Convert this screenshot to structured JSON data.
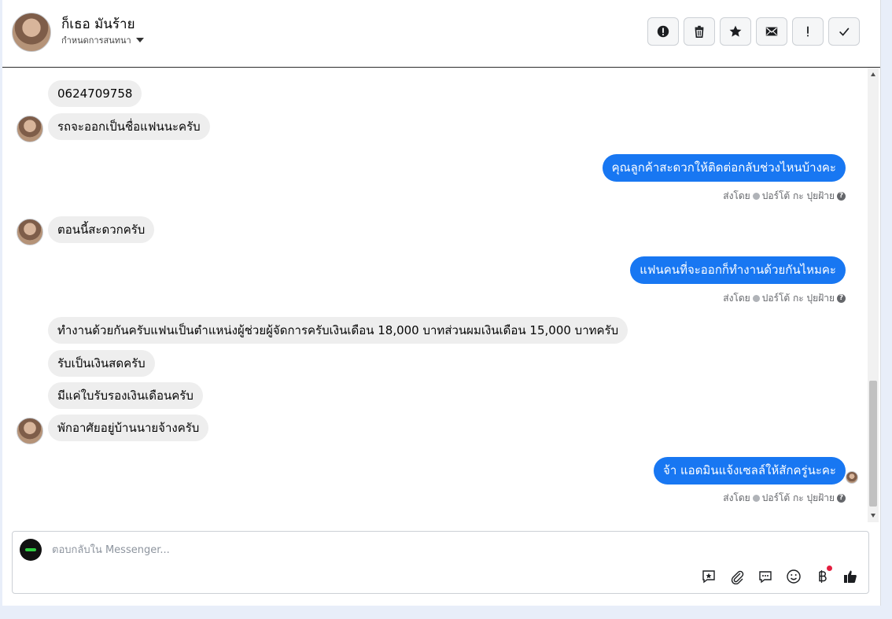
{
  "header": {
    "contact_name": "ก็เธอ มันร้าย",
    "assign_label": "กำหนดการสนทนา"
  },
  "actions": [
    {
      "name": "report-button",
      "icon": "alert-circle-icon"
    },
    {
      "name": "delete-button",
      "icon": "trash-icon"
    },
    {
      "name": "star-button",
      "icon": "star-icon"
    },
    {
      "name": "mark-unread-button",
      "icon": "envelope-icon"
    },
    {
      "name": "spam-button",
      "icon": "exclamation-icon"
    },
    {
      "name": "done-button",
      "icon": "check-icon"
    }
  ],
  "messages": [
    {
      "dir": "in",
      "text": "0624709758"
    },
    {
      "dir": "in",
      "text": "รถจะออกเป็นชื่อแฟนนะครับ"
    },
    {
      "dir": "out",
      "text": "คุณลูกค้าสะดวกให้ติดต่อกลับช่วงไหนบ้างคะ",
      "sent_by": "ส่งโดย",
      "sender": "ปอร์โต้ กะ ปุยฝ้าย"
    },
    {
      "dir": "in",
      "text": "ตอนนี้สะดวกครับ"
    },
    {
      "dir": "out",
      "text": "แฟนคนที่จะออกก็ทำงานด้วยกันไหมคะ",
      "sent_by": "ส่งโดย",
      "sender": "ปอร์โต้ กะ ปุยฝ้าย"
    },
    {
      "dir": "in",
      "text": "ทำงานด้วยกันครับแฟนเป็นตำแหน่งผู้ช่วยผู้จัดการครับเงินเดือน 18,000 บาทส่วนผมเงินเดือน 15,000 บาทครับ"
    },
    {
      "dir": "in",
      "text": "รับเป็นเงินสดครับ"
    },
    {
      "dir": "in",
      "text": "มีแค่ใบรับรองเงินเดือนครับ"
    },
    {
      "dir": "in",
      "text": "พักอาศัยอยู่บ้านนายจ้างครับ"
    },
    {
      "dir": "out",
      "text": "จ้า แอดมินแจ้งเซลล์ให้สักครู่นะคะ",
      "sent_by": "ส่งโดย",
      "sender": "ปอร์โต้ กะ ปุยฝ้าย"
    }
  ],
  "composer": {
    "placeholder": "ตอบกลับใน Messenger..."
  },
  "colors": {
    "outgoing_bubble": "#1877f2",
    "incoming_bubble": "#eeeeee"
  }
}
